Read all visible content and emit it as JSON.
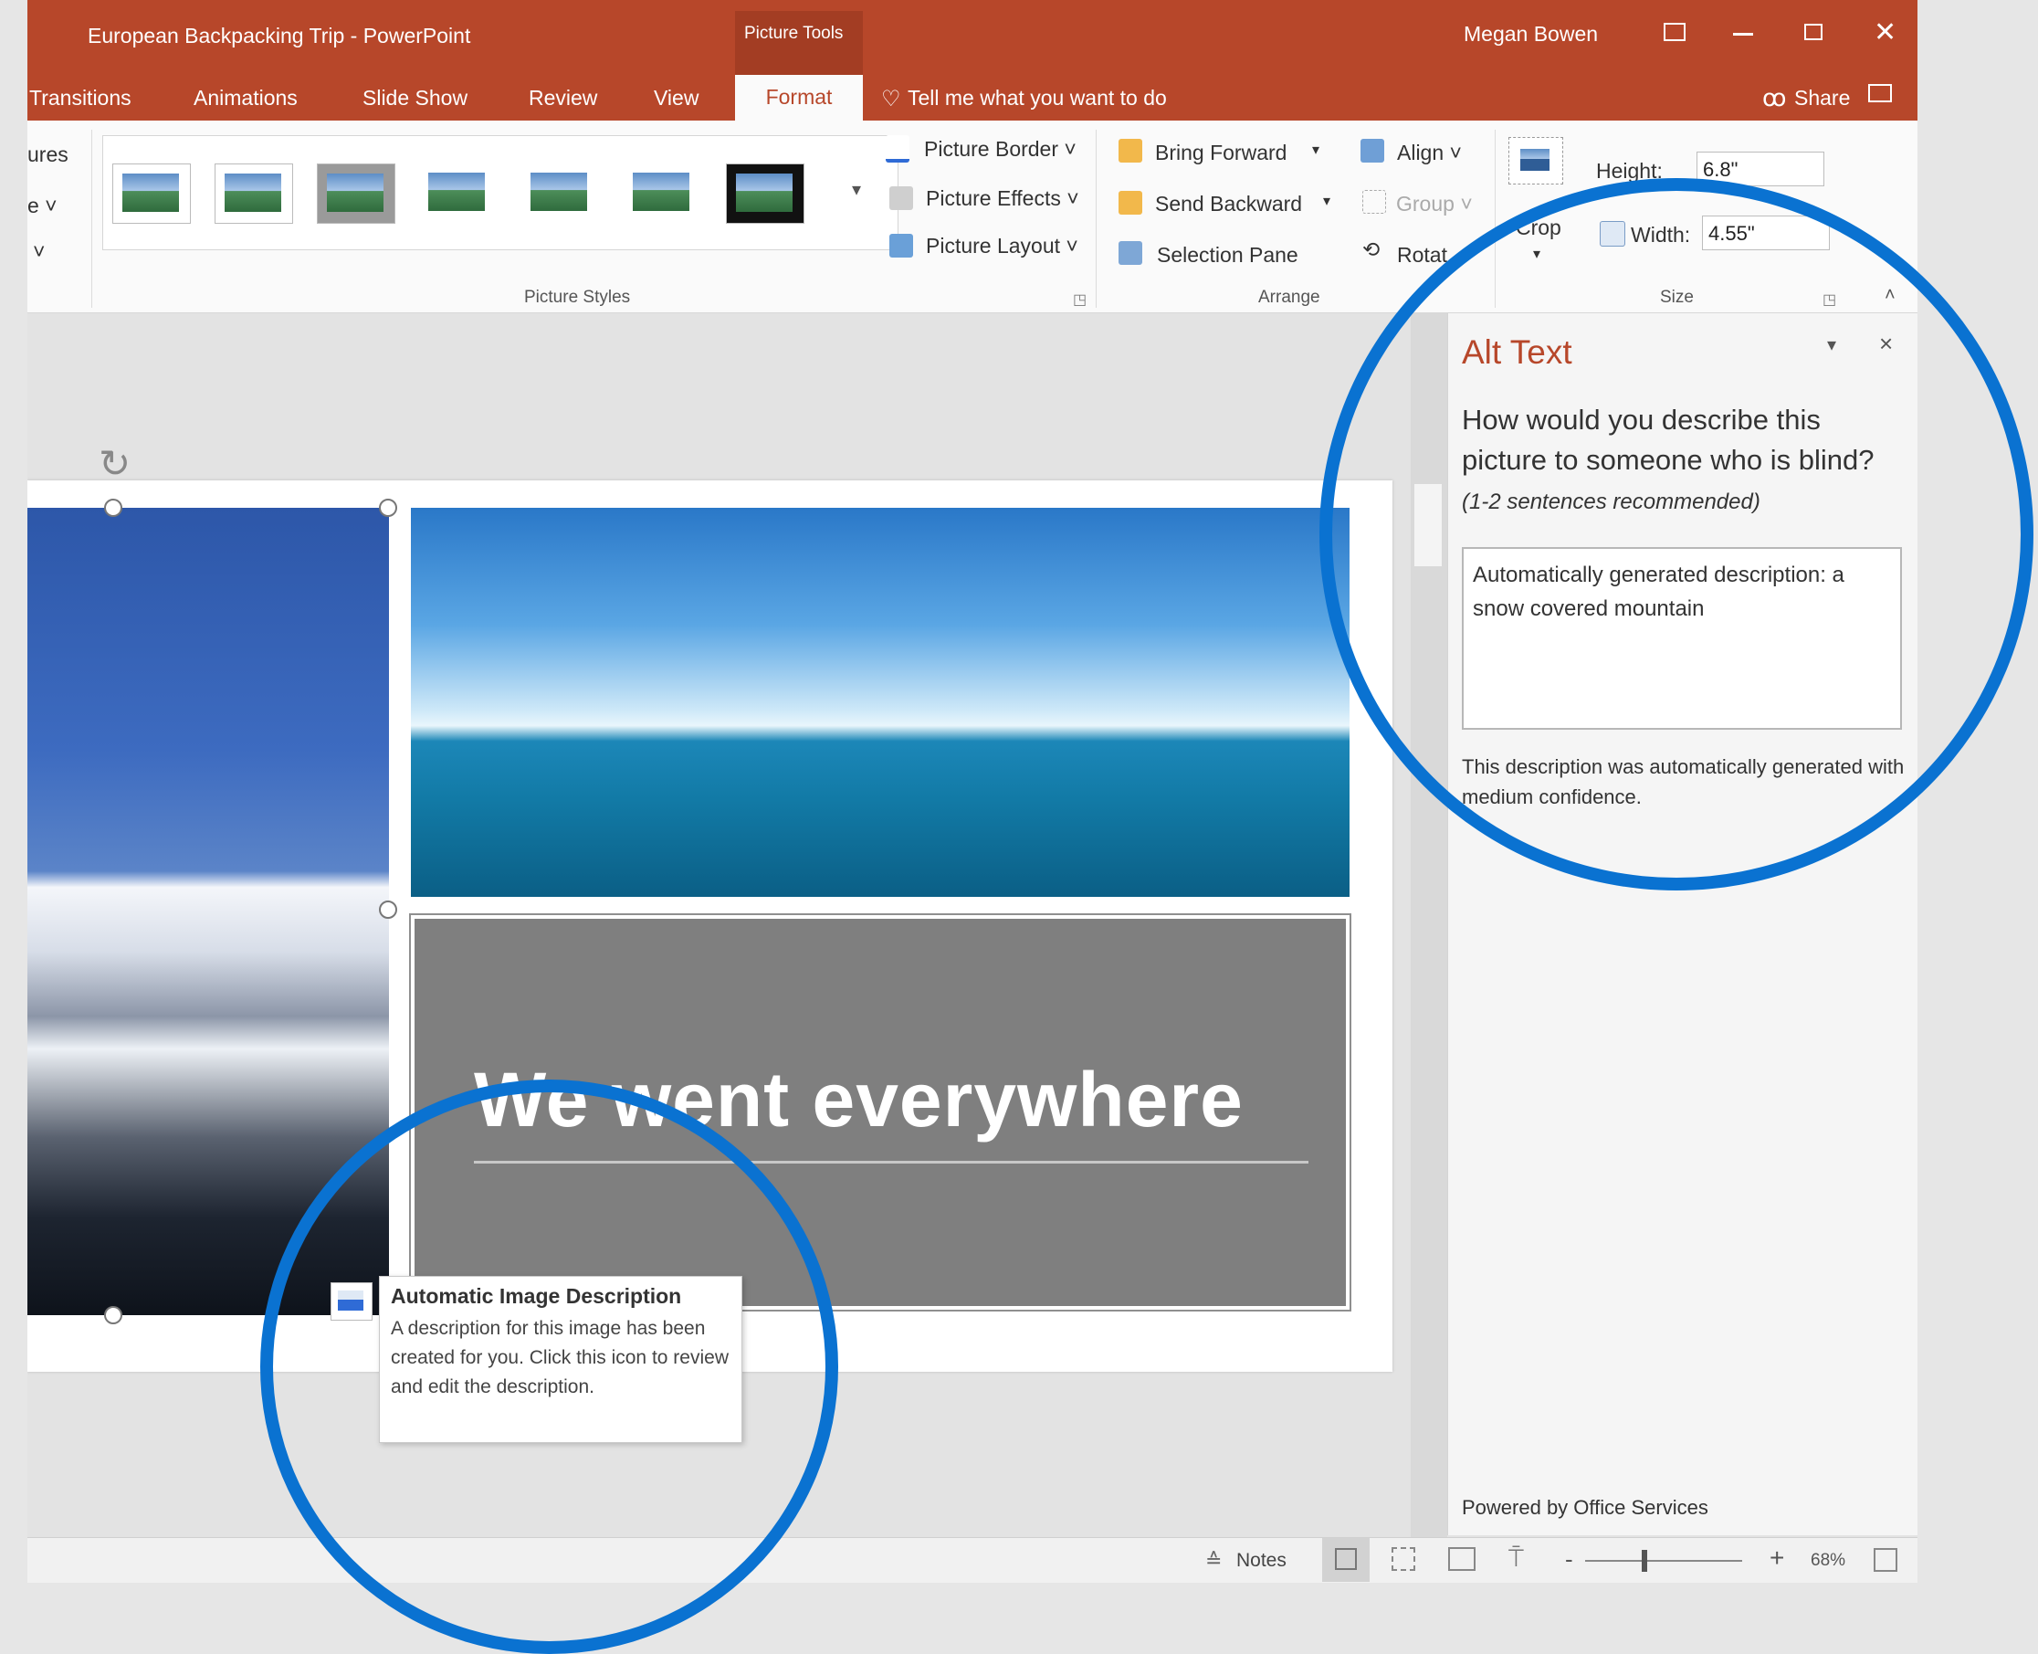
{
  "window": {
    "title": "European Backpacking Trip  -  PowerPoint",
    "context_tab_group": "Picture Tools",
    "user": "Megan Bowen"
  },
  "tabs": [
    "Transitions",
    "Animations",
    "Slide Show",
    "Review",
    "View",
    "Format"
  ],
  "tell_me": "Tell me what you want to do",
  "share": "Share",
  "ribbon": {
    "left_partial": [
      "ures",
      "e ˅",
      "˅"
    ],
    "picture_border": "Picture Border ˅",
    "picture_effects": "Picture Effects ˅",
    "picture_layout": "Picture Layout ˅",
    "group_picture_styles": "Picture Styles",
    "bring_forward": "Bring Forward",
    "send_backward": "Send Backward",
    "selection_pane": "Selection Pane",
    "align": "Align ˅",
    "group": "Group ˅",
    "rotate": "Rotat",
    "group_arrange": "Arrange",
    "crop": "Crop",
    "height_label": "Height:",
    "height_value": "6.8\"",
    "width_label": "Width:",
    "width_value": "4.55\"",
    "group_size": "Size"
  },
  "slide": {
    "title": "We went everywhere"
  },
  "tooltip": {
    "title": "Automatic Image Description",
    "body": "A description for this image has been created for you. Click this icon to review and edit the description."
  },
  "alt_text": {
    "pane_title": "Alt Text",
    "question": "How would you describe this picture to someone who is blind?",
    "hint": "(1-2 sentences recommended)",
    "description": "Automatically generated description: a snow covered mountain",
    "confidence_note": "This description was automatically generated with medium confidence.",
    "powered_by": "Powered by Office Services"
  },
  "status": {
    "notes": "Notes",
    "zoom_minus": "-",
    "zoom_plus": "+",
    "zoom": "68%"
  },
  "colors": {
    "accent": "#b7472a",
    "highlight_circle": "#0a72d1"
  }
}
